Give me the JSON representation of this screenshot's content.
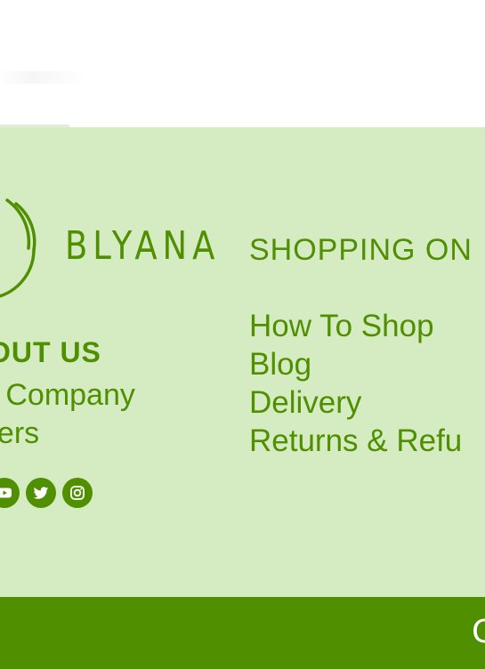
{
  "colors": {
    "brand_green": "#4f8f00",
    "footer_bg": "#d5ecc2",
    "bottom_bar_bg": "#4f8f00",
    "page_bg": "#ffffff"
  },
  "logo": {
    "text": "BLYANA",
    "icon": "circle-leaf-logo"
  },
  "about": {
    "title": "OUT US",
    "links": [
      {
        "label": "e Company"
      },
      {
        "label": "eers"
      }
    ]
  },
  "social": [
    {
      "icon": "youtube-icon"
    },
    {
      "icon": "twitter-icon"
    },
    {
      "icon": "instagram-icon"
    }
  ],
  "shopping": {
    "title": "SHOPPING ON",
    "links": [
      {
        "label": "How To Shop"
      },
      {
        "label": "Blog"
      },
      {
        "label": "Delivery"
      },
      {
        "label": "Returns & Refu"
      }
    ]
  },
  "bottom_bar": {
    "glyph": "C"
  }
}
